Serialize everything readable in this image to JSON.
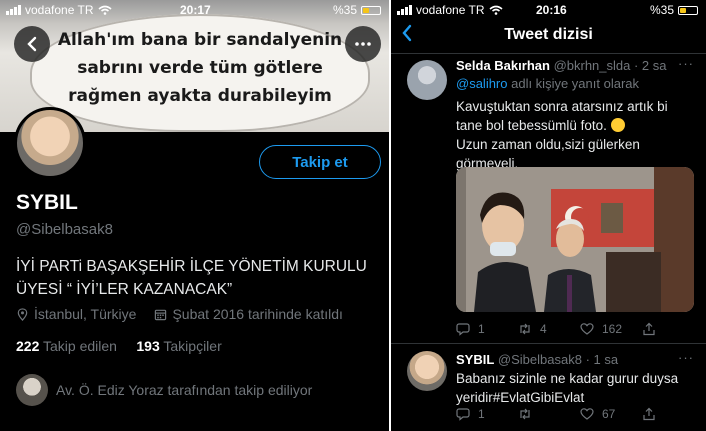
{
  "left": {
    "status": {
      "carrier": "vodafone TR",
      "time": "20:17",
      "battery": "%35",
      "battery_level": 0.35
    },
    "banner_text": "Allah'ım bana bir sandalyenin sabrını verde tüm götlere rağmen ayakta durabileyim",
    "back_icon": "chevron-left-icon",
    "more_icon": "more-icon",
    "follow_label": "Takip et",
    "profile": {
      "name": "SYBIL",
      "handle": "@Sibelbasak8",
      "bio": "İYİ PARTi BAŞAKŞEHİR İLÇE YÖNETİM KURULU ÜYESİ “ İYİ’LER KAZANACAK”",
      "location": "İstanbul, Türkiye",
      "joined": "Şubat 2016 tarihinde katıldı",
      "following_count": "222",
      "following_label": "Takip edilen",
      "followers_count": "193",
      "followers_label": "Takipçiler",
      "followed_by": "Av. Ö. Ediz Yoraz tarafından takip ediliyor"
    }
  },
  "right": {
    "status": {
      "carrier": "vodafone TR",
      "time": "20:16",
      "battery": "%35",
      "battery_level": 0.35
    },
    "title": "Tweet dizisi",
    "tweets": [
      {
        "name": "Selda Bakırhan",
        "handle": "@bkrhn_slda",
        "age": "· 2 sa",
        "reply_handle": "@salihro",
        "reply_suffix": " adlı kişiye yanıt olarak",
        "text1": "Kavuştuktan sonra atarsınız artık bi tane bol tebessümlü foto.",
        "text2": "Uzun zaman oldu,sizi gülerken görmeyeli.",
        "replies": "1",
        "retweets": "4",
        "likes": "162"
      },
      {
        "name": "SYBIL",
        "handle": "@Sibelbasak8",
        "age": "· 1 sa",
        "text1": "Babanız sizinle ne kadar gurur duysa yeridir#EvlatGibiEvlat",
        "replies": "1",
        "retweets": "",
        "likes": "67"
      }
    ]
  },
  "colors": {
    "accent": "#1d9bf0",
    "background": "#000000",
    "muted": "#71767b"
  }
}
